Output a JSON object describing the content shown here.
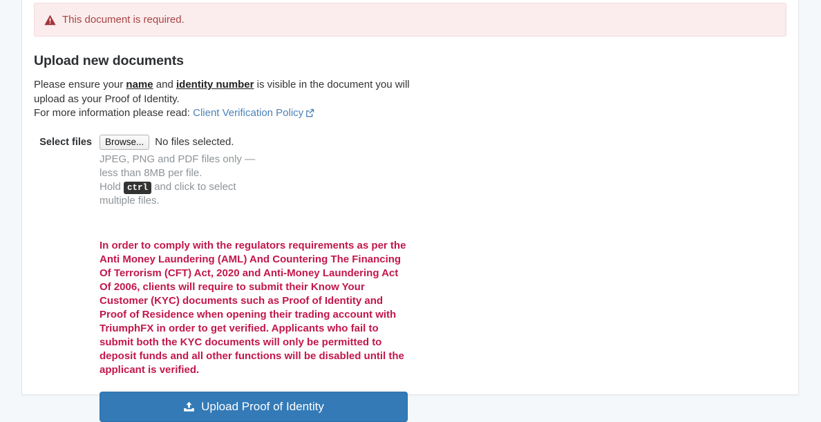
{
  "alert": {
    "icon": "warning-triangle-icon",
    "message": "This document is required."
  },
  "section": {
    "title": "Upload new documents",
    "intro_prefix": "Please ensure your ",
    "intro_strong_1": "name",
    "intro_mid": " and ",
    "intro_strong_2": "identity number",
    "intro_suffix": " is visible in the document you will upload as your Proof of Identity.",
    "policy_prefix": "For more information please read: ",
    "policy_link_label": "Client Verification Policy",
    "policy_link_icon": "external-link-icon"
  },
  "form": {
    "label": "Select files",
    "browse_button": "Browse...",
    "file_status": "No files selected.",
    "help_line_1": "JPEG, PNG and PDF files only — less than 8MB per file.",
    "help_hold": "Hold ",
    "help_key": "ctrl",
    "help_rest": " and click to select multiple files."
  },
  "notice": {
    "text": "In order to comply with the regulators requirements as per the Anti Money Laundering (AML) And Countering The Financing Of Terrorism (CFT) Act, 2020 and Anti-Money Laundering Act Of 2006, clients will require to submit their Know Your Customer (KYC) documents such as Proof of Identity and Proof of Residence when opening their trading account with TriumphFX in order to get verified. Applicants who fail to submit both the KYC documents will only be permitted to deposit funds and all other functions will be disabled until the applicant is verified."
  },
  "submit": {
    "label": "Upload Proof of Identity",
    "icon": "upload-icon"
  },
  "colors": {
    "primary": "#337ab7",
    "alert_bg": "#fbeced",
    "alert_text": "#a94442",
    "notice_red": "#c2174b",
    "link_blue": "#4b82b8",
    "help_gray": "#8e9499",
    "page_bg": "#f4f8fb"
  }
}
